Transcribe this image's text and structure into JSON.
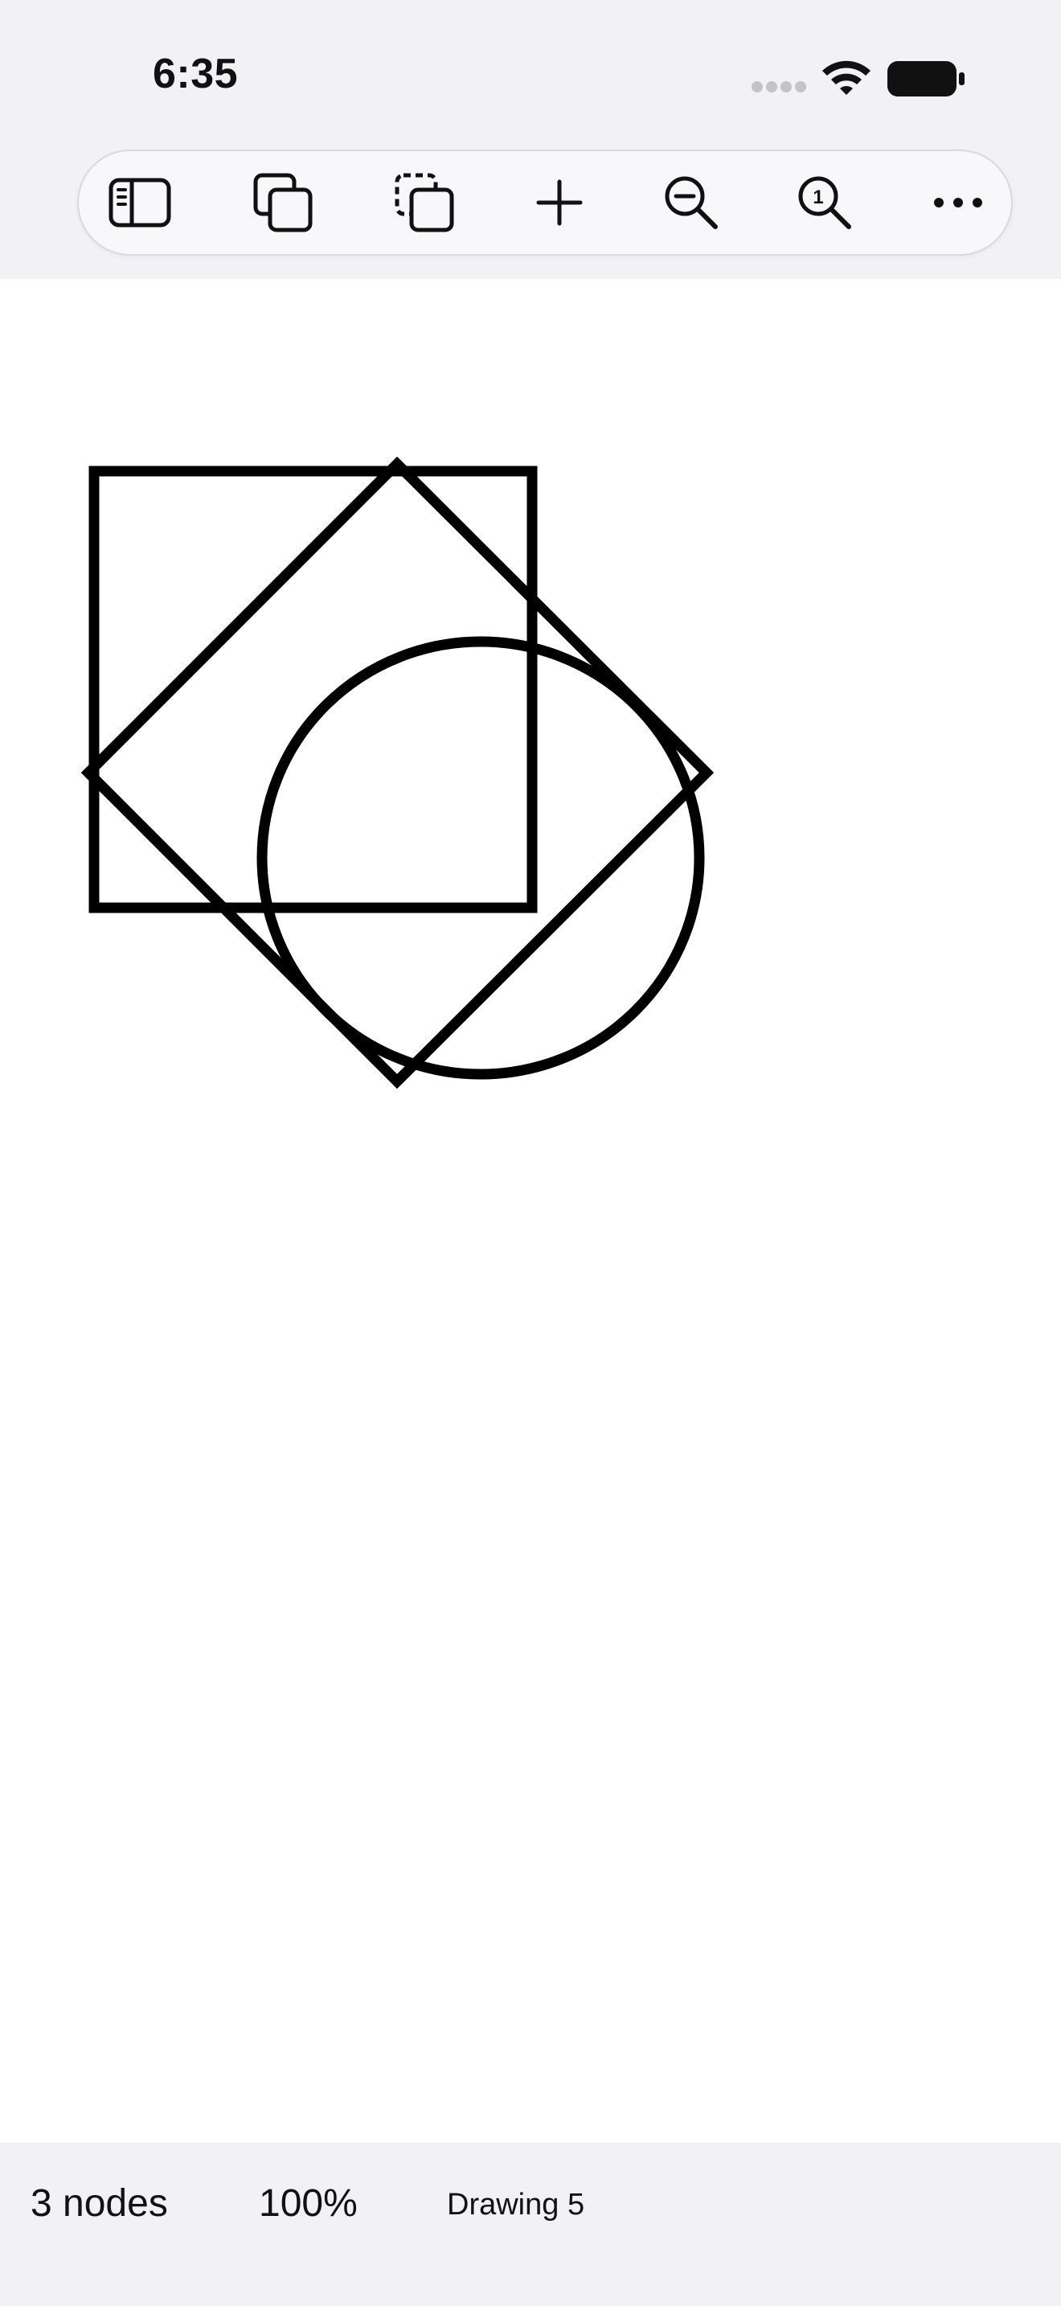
{
  "status_bar": {
    "time": "6:35",
    "icons": [
      "cellular-signal-icon",
      "wifi-icon",
      "battery-icon"
    ]
  },
  "toolbar": {
    "buttons": [
      {
        "name": "sidebar-toggle-button",
        "icon": "sidebar-icon"
      },
      {
        "name": "duplicate-button",
        "icon": "duplicate-icon"
      },
      {
        "name": "copy-selection-button",
        "icon": "dashed-copy-icon"
      },
      {
        "name": "add-button",
        "icon": "plus-icon"
      },
      {
        "name": "zoom-out-button",
        "icon": "zoom-out-icon"
      },
      {
        "name": "zoom-actual-size-button",
        "icon": "zoom-one-icon"
      },
      {
        "name": "more-button",
        "icon": "ellipsis-icon"
      }
    ]
  },
  "canvas": {
    "background": "#ffffff",
    "stroke_color": "#000000",
    "shapes": [
      {
        "type": "square"
      },
      {
        "type": "diamond"
      },
      {
        "type": "circle"
      }
    ]
  },
  "footer": {
    "node_count": "3 nodes",
    "zoom": "100%",
    "document_name": "Drawing 5"
  },
  "colors": {
    "chrome_background": "#f2f1f6",
    "text": "#111111"
  }
}
